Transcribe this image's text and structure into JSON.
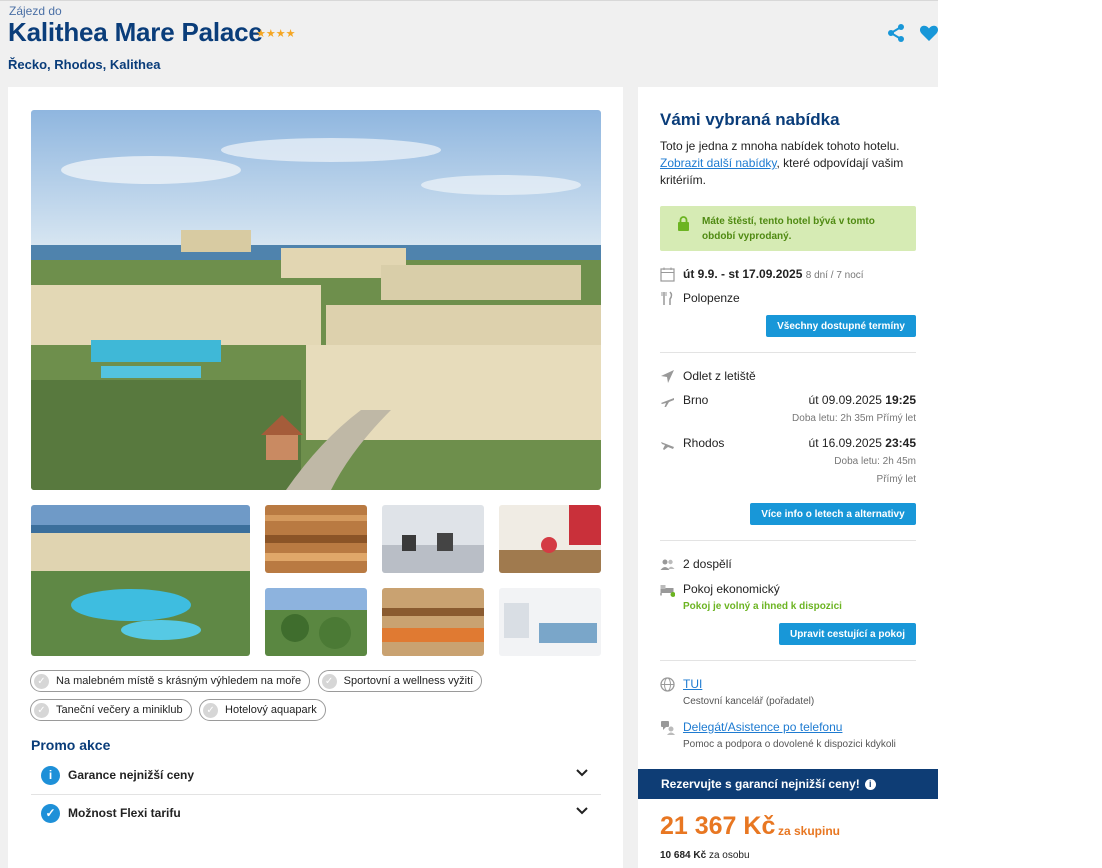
{
  "header": {
    "kicker": "Zájezd do",
    "title": "Kalithea Mare Palace",
    "stars": "★★★★",
    "location": "Řecko, Rhodos, Kalithea"
  },
  "gallery": {
    "main_alt": "Hotel complex with pools overlooking the sea",
    "thumbs": [
      "pool-aerial",
      "sauna",
      "gym",
      "fitness-room",
      "garden-view",
      "buffet-restaurant",
      "hotel-room"
    ]
  },
  "tags": [
    "Na malebném místě s krásným výhledem na moře",
    "Sportovní a wellness vyžití",
    "Taneční večery a miniklub",
    "Hotelový aquapark"
  ],
  "promo": {
    "title": "Promo akce",
    "items": [
      {
        "label": "Garance nejnižší ceny",
        "icon": "i"
      },
      {
        "label": "Možnost Flexi tarifu",
        "icon": "✓"
      }
    ]
  },
  "offer": {
    "title": "Vámi vybraná nabídka",
    "intro_1": "Toto je jedna z mnoha nabídek tohoto hotelu.",
    "intro_link": "Zobrazit další nabídky",
    "intro_2": ", které odpovídají vašim kritériím.",
    "alert": "Máte štěstí, tento hotel bývá v tomto období vyprodaný.",
    "dates": "út 9.9. - st 17.09.2025",
    "duration": "8 dní / 7 nocí",
    "board": "Polopenze",
    "all_dates_btn": "Všechny dostupné termíny",
    "departure_label": "Odlet z letiště",
    "flight_out": {
      "from": "Brno",
      "date": "út 09.09.2025",
      "time": "19:25",
      "detail": "Doba letu: 2h 35m  Přímý let"
    },
    "flight_back": {
      "from": "Rhodos",
      "date": "út 16.09.2025",
      "time": "23:45",
      "detail": "Doba letu: 2h 45m",
      "detail2": "Přímý let"
    },
    "flight_info_btn": "Více info o letech a alternativy",
    "travellers": "2 dospělí",
    "room": "Pokoj ekonomický",
    "room_status": "Pokoj je volný a ihned k dispozici",
    "edit_btn": "Upravit cestující a pokoj",
    "organizer_link": "TUI",
    "organizer_desc": "Cestovní kancelář (pořadatel)",
    "assist_link": "Delegát/Asistence po telefonu",
    "assist_desc": "Pomoc a podpora o dovolené k dispozici kdykoli"
  },
  "booking": {
    "banner": "Rezervujte s garancí nejnižší ceny!",
    "price": "21 367 Kč",
    "price_unit": "za skupinu",
    "per_person_value": "10 684 Kč",
    "per_person_label": "za osobu"
  },
  "colors": {
    "brand": "#0a3d7a",
    "accent": "#1897d8",
    "price": "#e87722",
    "success": "#d6ebb4"
  }
}
